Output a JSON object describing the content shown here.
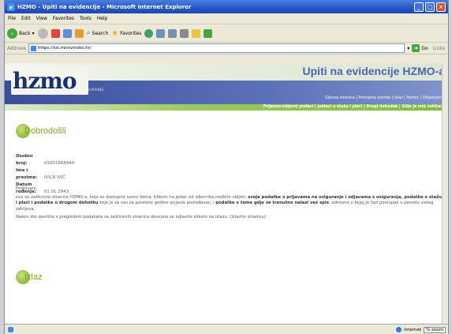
{
  "window": {
    "title": "HZMO - Upiti na evidencije - Microsoft Internet Explorer",
    "icon": "ie-icon"
  },
  "menu": [
    "File",
    "Edit",
    "View",
    "Favorites",
    "Tools",
    "Help"
  ],
  "toolbar": {
    "back_label": "Back",
    "search_label": "Search",
    "favorites_label": "Favorites"
  },
  "address": {
    "label": "Address",
    "url": "https://ssl.mirovinsko.hr/",
    "go_label": "Go",
    "links_label": "Links"
  },
  "site": {
    "logo_text": "hzmo",
    "tagline": "HRVATSKI ZAVOD ZA MIROVINSKO OSIGURANJE",
    "app_title": "Upiti na evidencije HZMO-a",
    "top_nav": "Glavna stranica | Promjena lozinke | Izlaz | Pomoć | Objašnjenja",
    "green_nav": "Prijavno-odjavni podaci | podaci o stažu i plaći | Drugi dohodak | Gdje je moj zahtjev?"
  },
  "welcome": {
    "text": "Dobrodošli"
  },
  "user_info": {
    "oib_label": "Osobni broj:",
    "oib_value": "03001968944",
    "name_label": "Ime i prezime:",
    "name_value": "IVICA IVIĆ",
    "dob_label": "Datum rođenja:",
    "dob_value": "01.01.1943."
  },
  "message": {
    "greeting": "Poštovani,",
    "para1_a": "ovo su zaštićene stranice HZMO-a, koje su dostupne samo Vama. Klikom na jedan od izbornika možete vidjeti: ",
    "para1_b": "svoje podatke o prijavama na osiguranje i odjavama s osiguranja, podatke o stažu i plaći i podatke o drugom dohotku",
    "para1_c": " koje je za vas za posebne godine prijavio poslodavac, i ",
    "para1_d": "podatke o tome gdje se trenutno nalazi vaš spis",
    "para1_e": ", odnosno u kojoj je fazi postupak u povodu vašeg zahtjeva.",
    "para2": "Nakon što završite s pregledom podataka sa zaštićenih stranica obvezno se odjavite klikom na izlazu. (Izlazite stranicu)"
  },
  "logout": {
    "text": "Izlaz"
  },
  "status": {
    "zone": "Internet",
    "zoom": "% zoom"
  },
  "colors": {
    "accent_blue": "#4a64b8",
    "accent_green": "#7daa22",
    "titlebar_blue": "#2456c7"
  }
}
